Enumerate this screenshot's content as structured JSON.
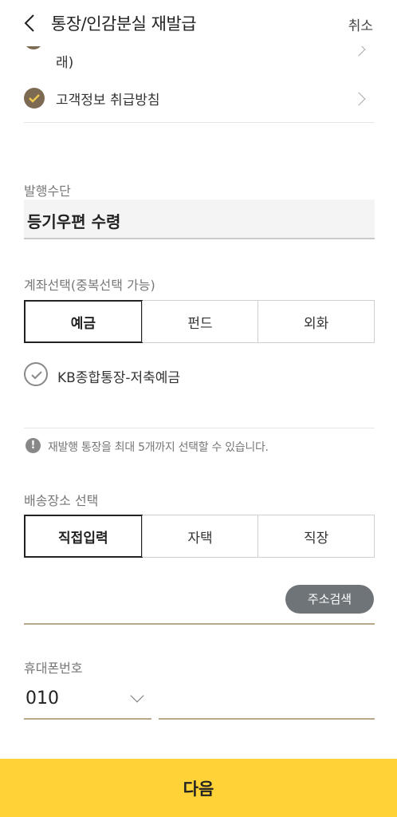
{
  "header": {
    "title": "통장/인감분실 재발급",
    "cancel_label": "취소"
  },
  "terms": {
    "clipped_text": "래)",
    "privacy_label": "고객정보 취급방침"
  },
  "issue_method": {
    "label": "발행수단",
    "value": "등기우편 수령"
  },
  "account_select": {
    "label": "계좌선택(중복선택 가능)",
    "tabs": [
      "예금",
      "펀드",
      "외화"
    ],
    "active_tab": "예금",
    "account_label": "KB종합통장-저축예금"
  },
  "notice": {
    "icon": "!",
    "text": "재발행 통장을 최대 5개까지 선택할 수 있습니다."
  },
  "delivery": {
    "label": "배송장소 선택",
    "tabs": [
      "직접입력",
      "자택",
      "직장"
    ],
    "active_tab": "직접입력",
    "address_search_label": "주소검색"
  },
  "phone": {
    "label": "휴대폰번호",
    "prefix": "010",
    "number": ""
  },
  "footer": {
    "next_label": "다음"
  },
  "colors": {
    "accent_yellow": "#ffd338",
    "check_brown": "#7d6a52",
    "gold_underline": "#b8a98a"
  }
}
